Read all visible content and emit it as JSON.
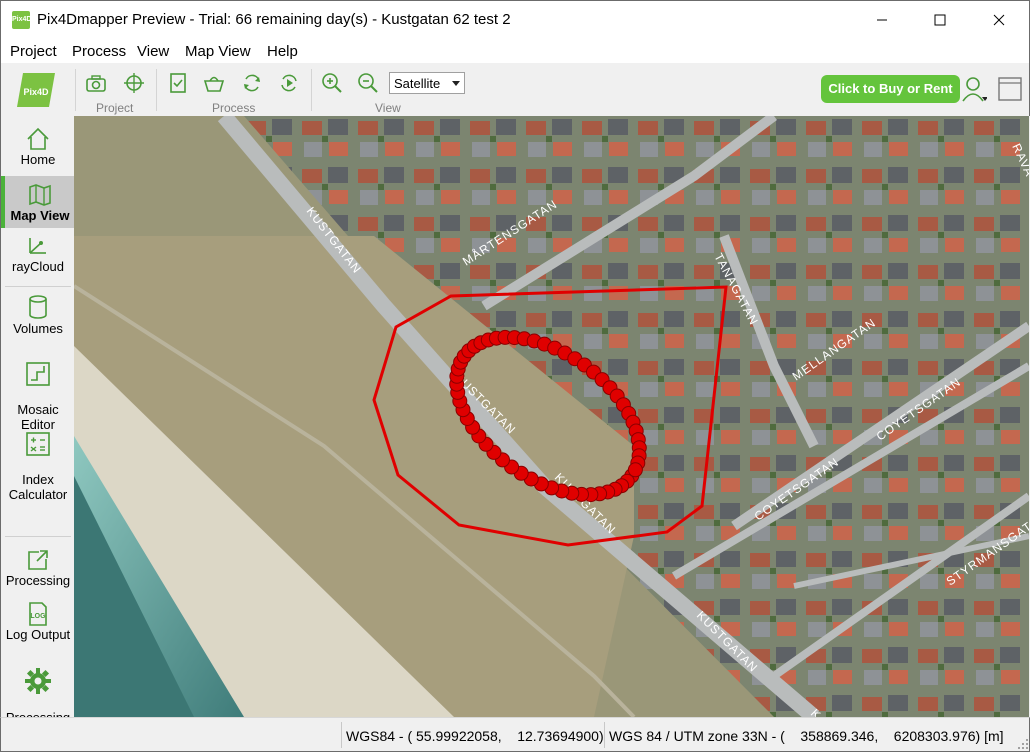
{
  "window": {
    "title": "Pix4Dmapper Preview - Trial: 66 remaining day(s) - Kustgatan 62 test 2",
    "app_icon_text": "Pix4D"
  },
  "menu": [
    "Project",
    "Process",
    "View",
    "Map View",
    "Help"
  ],
  "toolbar": {
    "groups": [
      "Project",
      "Process",
      "View"
    ],
    "basemap_select": "Satellite",
    "buy_button": "Click to Buy or Rent",
    "logo_text": "Pix4D"
  },
  "sidebar": {
    "items": [
      "Home",
      "Map View",
      "rayCloud",
      "Volumes",
      "Mosaic\nEditor",
      "Index\nCalculator",
      "Processing",
      "Log Output",
      "Processing\nOptions"
    ]
  },
  "map": {
    "street_labels": [
      "KUSTGATAN",
      "MÅRTENSGATAN",
      "TANAGATAN",
      "MELLANGATAN",
      "KUSTGATAN",
      "KUSTGATAN",
      "COYETSGATAN",
      "COYETSGATAN",
      "KUSTGATAN",
      "STYRMANSGATAN",
      "RAVA",
      "K"
    ],
    "colors": {
      "polygon": "#e00000",
      "image_points": "#e00000"
    }
  },
  "status": {
    "wgs84": "WGS84 - ( 55.99922058,    12.73694900)",
    "utm": "WGS 84 / UTM zone 33N - (    358869.346,    6208303.976) [m]"
  }
}
